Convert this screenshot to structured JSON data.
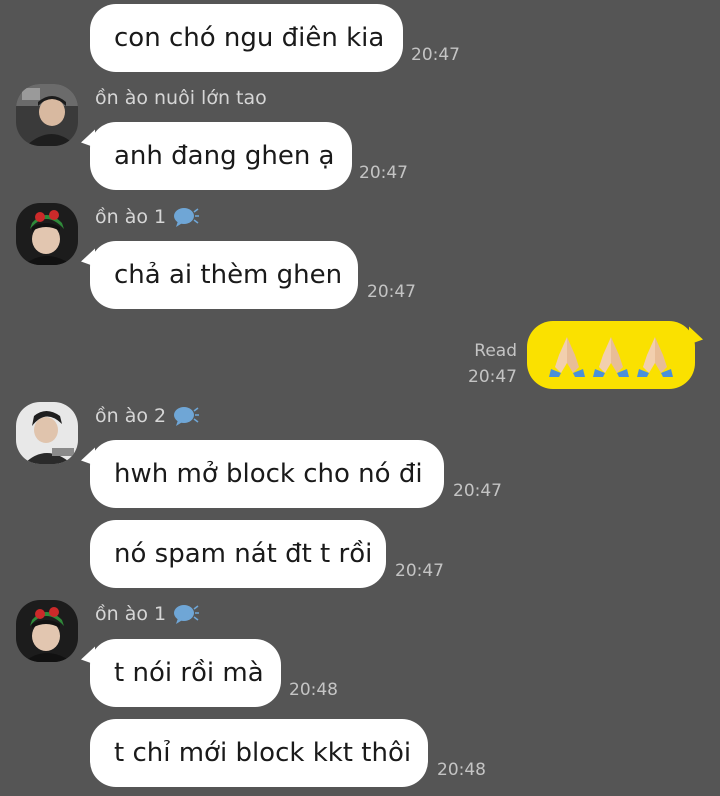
{
  "chat": {
    "messages": [
      {
        "text": "con chó ngu điên kia",
        "time": "20:47"
      },
      {
        "sender": "ồn ào nuôi lớn tao",
        "text": "anh đang ghen ạ",
        "time": "20:47"
      },
      {
        "sender": "ồn ào 1",
        "text": "chả ai thèm ghen",
        "time": "20:47"
      },
      {
        "status": "Read",
        "time": "20:47",
        "emoji": "🙏🙏🙏",
        "icon": "pray-icon"
      },
      {
        "sender": "ồn ào 2",
        "text": "hwh mở block cho nó đi",
        "time": "20:47"
      },
      {
        "text": "nó spam nát đt t rồi",
        "time": "20:47"
      },
      {
        "sender": "ồn ào 1",
        "text": "t nói rồi mà",
        "time": "20:48"
      },
      {
        "text": "t chỉ mới block kkt thôi",
        "time": "20:48"
      }
    ]
  },
  "colors": {
    "background": "#555555",
    "incoming_bubble": "#ffffff",
    "outgoing_bubble": "#fae100",
    "meta_text": "#c4c4c4"
  }
}
